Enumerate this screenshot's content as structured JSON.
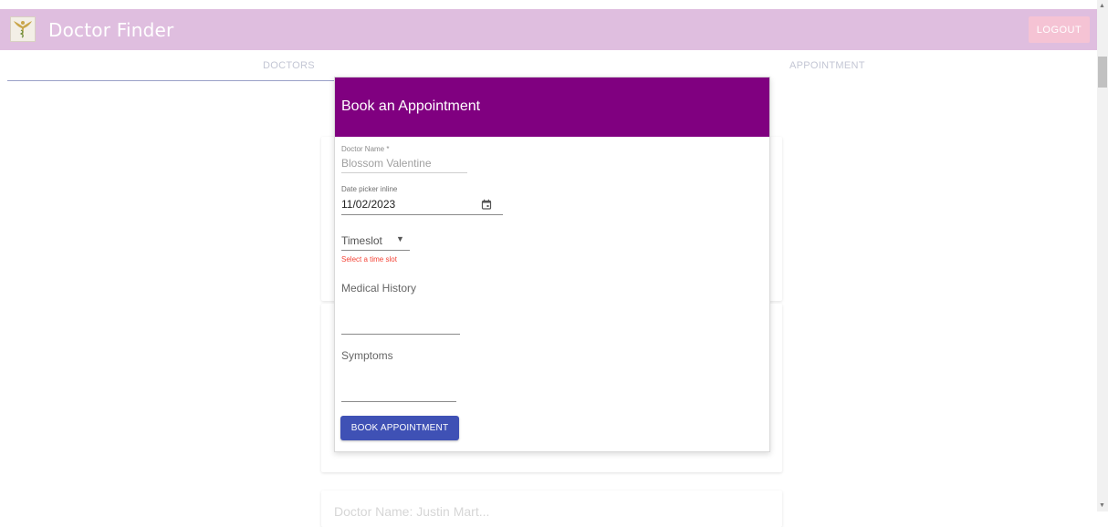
{
  "appbar": {
    "title": "Doctor Finder",
    "logout_label": "LOGOUT",
    "logo_icon": "caduceus-icon",
    "background_color": "#dfbedf"
  },
  "tabs": [
    {
      "label": "DOCTORS"
    },
    {
      "label": "APPOINTMENT"
    }
  ],
  "background_cards": {
    "partial_text": "Doctor Name: Justin Mart..."
  },
  "dialog": {
    "title": "Book an Appointment",
    "header_color": "#800080",
    "doctor_name": {
      "label": "Doctor Name *",
      "value": "Blossom Valentine"
    },
    "date_picker": {
      "label": "Date picker inline",
      "value": "11/02/2023",
      "icon": "calendar-icon"
    },
    "timeslot": {
      "placeholder": "Timeslot",
      "error": "Select a time slot",
      "icon": "caret-down-icon"
    },
    "medical_history": {
      "label": "Medical History"
    },
    "symptoms": {
      "label": "Symptoms"
    },
    "submit_label": "BOOK APPOINTMENT",
    "submit_color": "#3f51b5"
  }
}
